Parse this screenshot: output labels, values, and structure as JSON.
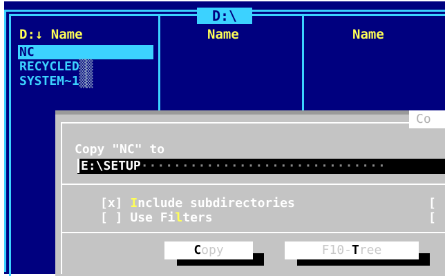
{
  "panel": {
    "title": "D:\\",
    "drive_label": "D:↓",
    "columns": [
      "Name",
      "Name",
      "Name"
    ],
    "files": [
      {
        "name": "NC",
        "selected": true
      },
      {
        "name": "RECYCLED",
        "selected": false
      },
      {
        "name": "SYSTEM~1",
        "selected": false
      }
    ]
  },
  "dialog": {
    "title": "Co",
    "prompt": "Copy \"NC\" to",
    "destination": "E:\\SETUP",
    "options": [
      {
        "checkbox": "[x]",
        "pre": "",
        "hot": "I",
        "post": "nclude subdirectories",
        "checked": true
      },
      {
        "checkbox": "[ ]",
        "pre": "Use Fi",
        "hot": "l",
        "post": "ters",
        "checked": false
      }
    ],
    "right_brackets": [
      "[",
      "["
    ],
    "buttons": [
      {
        "pre": "",
        "hot": "C",
        "post": "opy"
      },
      {
        "pre": "F10-",
        "hot": "T",
        "post": "ree"
      }
    ]
  },
  "colors": {
    "panel_bg": "#00007f",
    "frame": "#3cd2ff",
    "header": "#ffff55",
    "dialog_bg": "#c4c4c4"
  }
}
